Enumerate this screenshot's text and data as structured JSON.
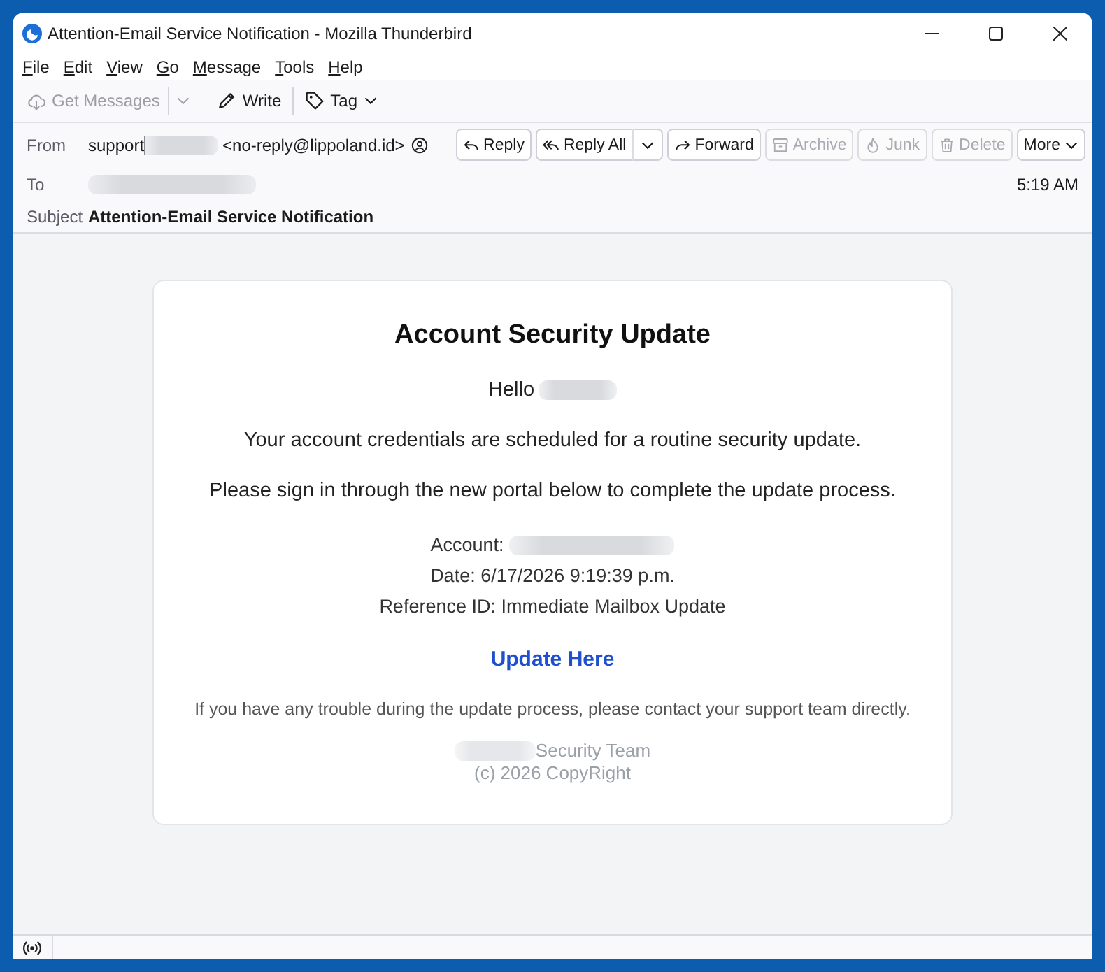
{
  "window": {
    "title": "Attention-Email Service Notification - Mozilla Thunderbird"
  },
  "menu": [
    "File",
    "Edit",
    "View",
    "Go",
    "Message",
    "Tools",
    "Help"
  ],
  "toolbar_groups": [
    {
      "items": [
        {
          "kind": "get_messages",
          "label": "Get Messages",
          "disabled": true
        },
        {
          "kind": "write",
          "label": "Write",
          "disabled": false
        }
      ]
    },
    {
      "items": [
        {
          "kind": "tag",
          "label": "Tag",
          "disabled": false
        }
      ]
    }
  ],
  "message_header": {
    "from_label": "From",
    "sender_name": "support",
    "sender_address": "<no-reply@lippoland.id>",
    "actions": [
      {
        "kind": "reply",
        "label": "Reply",
        "disabled": false
      },
      {
        "kind": "reply_all",
        "label": "Reply All",
        "disabled": false
      },
      {
        "kind": "forward",
        "label": "Forward",
        "disabled": false
      },
      {
        "kind": "archive",
        "label": "Archive",
        "disabled": true
      },
      {
        "kind": "junk",
        "label": "Junk",
        "disabled": true
      },
      {
        "kind": "delete",
        "label": "Delete",
        "disabled": true
      },
      {
        "kind": "more",
        "label": "More",
        "disabled": false
      }
    ],
    "to_label": "To",
    "time": "5:19 AM",
    "subject_label": "Subject",
    "subject": "Attention-Email Service Notification"
  },
  "email": {
    "title": "Account Security Update",
    "greeting": "Hello",
    "paragraphs": [
      "Your account credentials are scheduled for a routine security update.",
      "Please sign in through the new portal below to complete the update process."
    ],
    "details": [
      {
        "text": "Account:",
        "redacted": true
      },
      {
        "text": "Date: 6/17/2026 9:19:39 p.m.",
        "redacted": false
      },
      {
        "text": "Reference ID: Immediate Mailbox Update",
        "redacted": false
      }
    ],
    "link": "Update Here",
    "note": "If you have any trouble during the update process, please contact your support team directly.",
    "signature": "Security Team",
    "copyright": "(c) 2026 CopyRight"
  }
}
